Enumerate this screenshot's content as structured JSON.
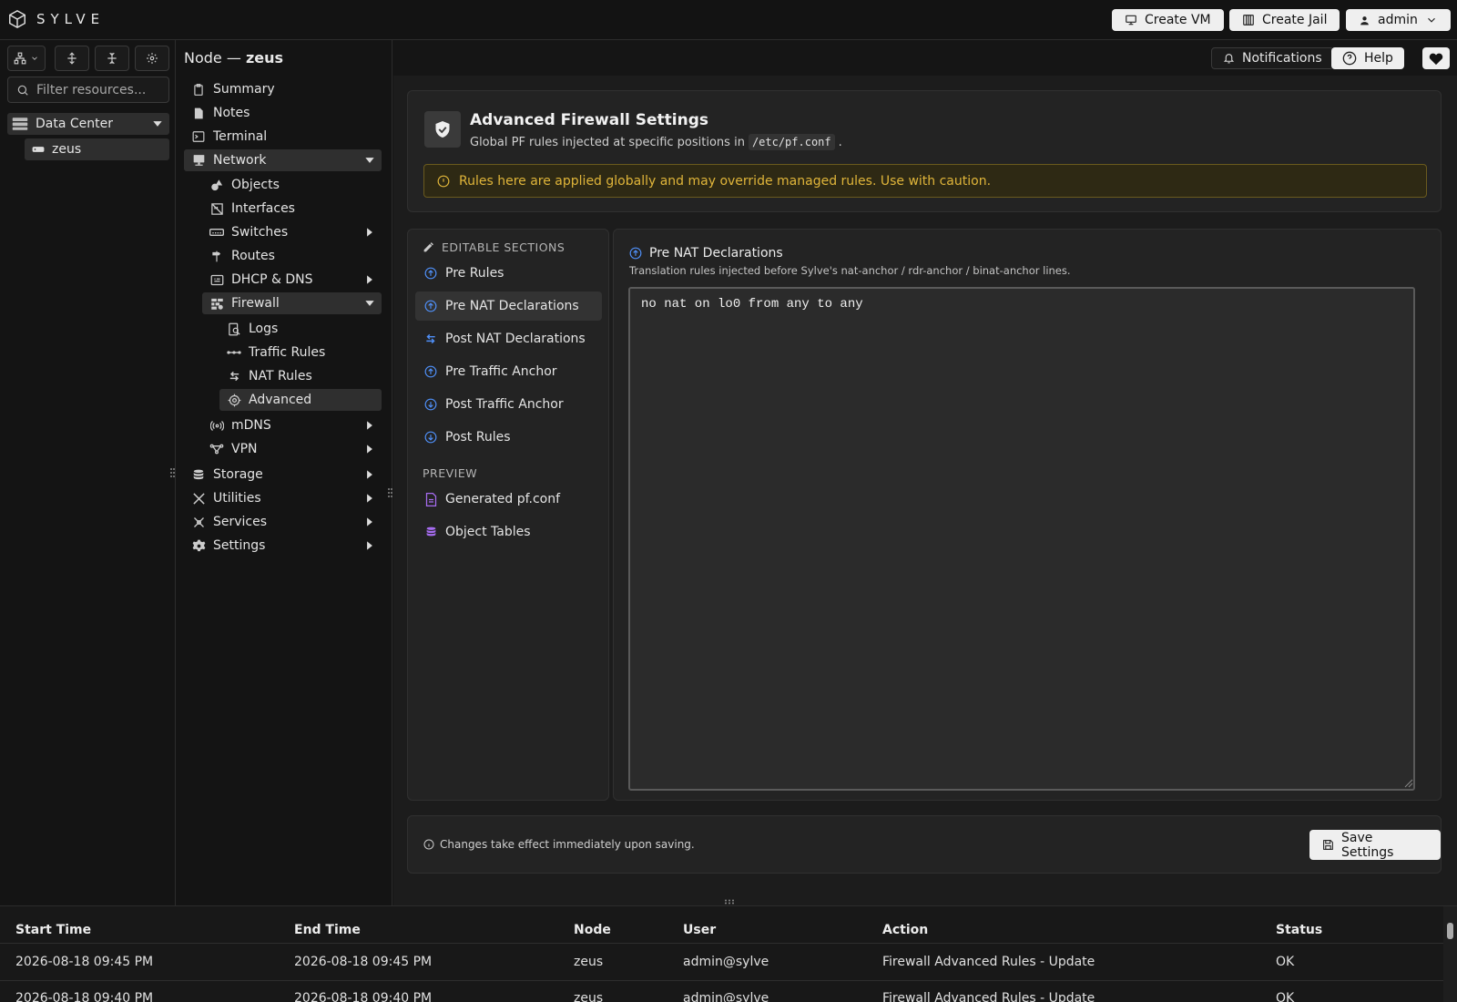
{
  "app": {
    "brand": "SYLVE"
  },
  "topbar": {
    "create_vm": "Create VM",
    "create_jail": "Create Jail",
    "user": "admin"
  },
  "tree": {
    "filter_placeholder": "Filter resources...",
    "datacenter": "Data Center",
    "node": "zeus"
  },
  "header": {
    "node_prefix": "Node — ",
    "node_name": "zeus",
    "notifications": "Notifications",
    "help": "Help"
  },
  "nav": {
    "summary": "Summary",
    "notes": "Notes",
    "terminal": "Terminal",
    "network": "Network",
    "objects": "Objects",
    "interfaces": "Interfaces",
    "switches": "Switches",
    "routes": "Routes",
    "dhcp_dns": "DHCP & DNS",
    "firewall": "Firewall",
    "logs": "Logs",
    "traffic_rules": "Traffic Rules",
    "nat_rules": "NAT Rules",
    "advanced": "Advanced",
    "mdns": "mDNS",
    "vpn": "VPN",
    "storage": "Storage",
    "utilities": "Utilities",
    "services": "Services",
    "settings": "Settings"
  },
  "page": {
    "title": "Advanced Firewall Settings",
    "subtitle_prefix": "Global PF rules injected at specific positions in",
    "subtitle_path": "/etc/pf.conf",
    "subtitle_suffix": ".",
    "warning": "Rules here are applied globally and may override managed rules. Use with caution."
  },
  "sections": {
    "editable_heading": "EDITABLE SECTIONS",
    "items": [
      "Pre Rules",
      "Pre NAT Declarations",
      "Post NAT Declarations",
      "Pre Traffic Anchor",
      "Post Traffic Anchor",
      "Post Rules"
    ],
    "preview_heading": "PREVIEW",
    "preview_items": [
      "Generated pf.conf",
      "Object Tables"
    ],
    "selected": "Pre NAT Declarations"
  },
  "editor": {
    "title": "Pre NAT Declarations",
    "description": "Translation rules injected before Sylve's nat-anchor / rdr-anchor / binat-anchor lines.",
    "content": "no nat on lo0 from any to any"
  },
  "footer": {
    "note": "Changes take effect immediately upon saving.",
    "save": "Save Settings"
  },
  "log_table": {
    "columns": [
      "Start Time",
      "End Time",
      "Node",
      "User",
      "Action",
      "Status"
    ],
    "rows": [
      [
        "2026-08-18 09:45 PM",
        "2026-08-18 09:45 PM",
        "zeus",
        "admin@sylve",
        "Firewall Advanced Rules - Update",
        "OK"
      ],
      [
        "2026-08-18 09:40 PM",
        "2026-08-18 09:40 PM",
        "zeus",
        "admin@sylve",
        "Firewall Advanced Rules - Update",
        "OK"
      ]
    ]
  },
  "colors": {
    "accent_blue": "#4f8ff7",
    "warning": "#e0b53a",
    "purple": "#a66cf0"
  }
}
